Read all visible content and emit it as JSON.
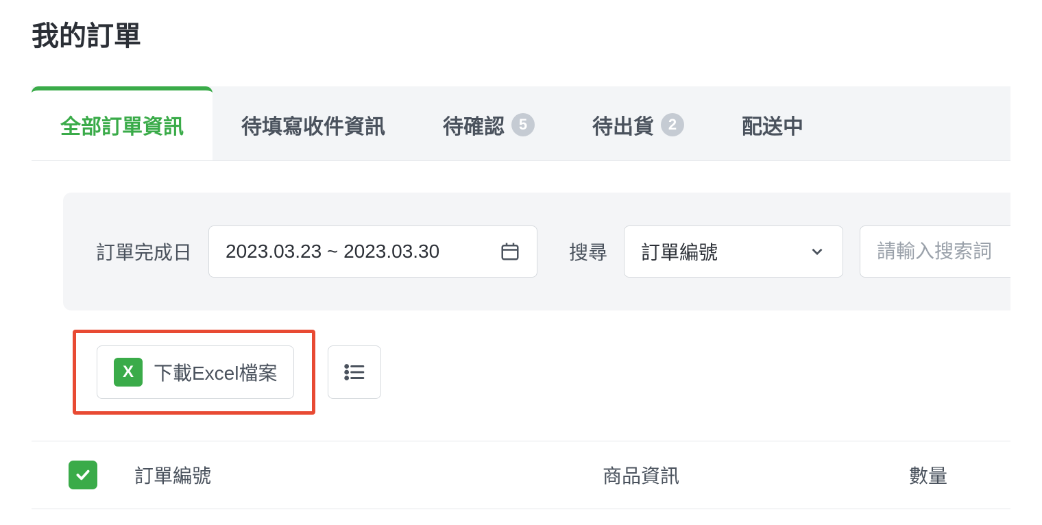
{
  "page": {
    "title": "我的訂單"
  },
  "tabs": [
    {
      "label": "全部訂單資訊",
      "badge": null,
      "active": true
    },
    {
      "label": "待填寫收件資訊",
      "badge": null,
      "active": false
    },
    {
      "label": "待確認",
      "badge": "5",
      "active": false
    },
    {
      "label": "待出貨",
      "badge": "2",
      "active": false
    },
    {
      "label": "配送中",
      "badge": null,
      "active": false
    }
  ],
  "filters": {
    "date_label": "訂單完成日",
    "date_value": "2023.03.23 ~ 2023.03.30",
    "search_label": "搜尋",
    "search_type": "訂單編號",
    "search_placeholder": "請輸入搜索詞"
  },
  "actions": {
    "download_excel": "下載Excel檔案"
  },
  "table": {
    "columns": {
      "order_no": "訂單編號",
      "product": "商品資訊",
      "qty": "數量"
    }
  },
  "icons": {
    "excel_letter": "X"
  }
}
